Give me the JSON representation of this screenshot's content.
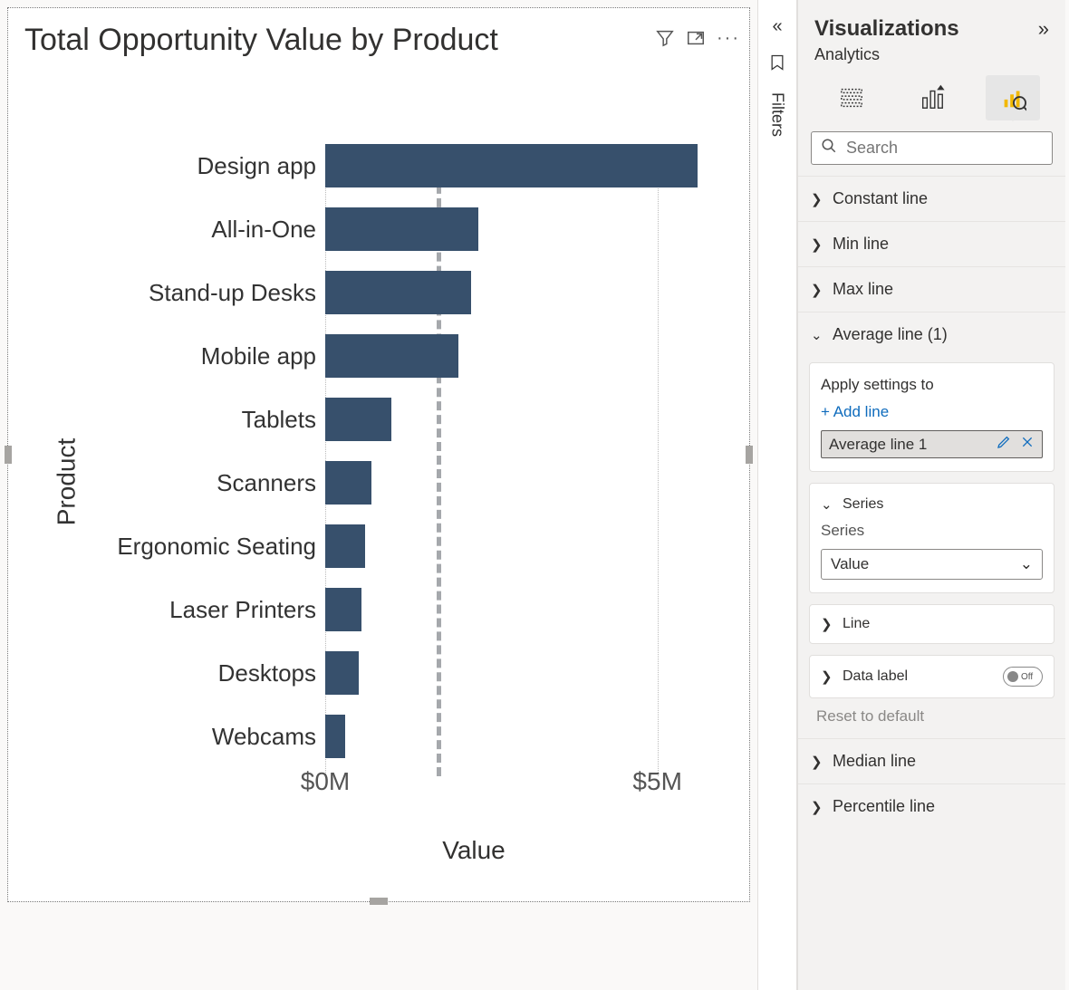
{
  "chart_data": {
    "type": "bar",
    "orientation": "horizontal",
    "title": "Total Opportunity Value by Product",
    "xlabel": "Value",
    "ylabel": "Product",
    "xlim": [
      0,
      6
    ],
    "ticks": [
      {
        "pos": 0,
        "label": "$0M"
      },
      {
        "pos": 5,
        "label": "$5M"
      }
    ],
    "average_line_value": 1.7,
    "categories": [
      "Design app",
      "All-in-One",
      "Stand-up Desks",
      "Mobile app",
      "Tablets",
      "Scanners",
      "Ergonomic Seating",
      "Laser Printers",
      "Desktops",
      "Webcams"
    ],
    "values": [
      5.6,
      2.3,
      2.2,
      2.0,
      1.0,
      0.7,
      0.6,
      0.55,
      0.5,
      0.3
    ]
  },
  "chart_actions": {
    "filter_tooltip": "Filters on this visual",
    "focus_tooltip": "Focus mode",
    "more_tooltip": "More options"
  },
  "filters_strip": {
    "label": "Filters"
  },
  "pane": {
    "title": "Visualizations",
    "subtitle": "Analytics",
    "search_placeholder": "Search",
    "sections": {
      "constant_line": "Constant line",
      "min_line": "Min line",
      "max_line": "Max line",
      "average_line": "Average line (1)",
      "median_line": "Median line",
      "percentile_line": "Percentile line"
    },
    "average_card": {
      "apply_label": "Apply settings to",
      "add_line": "+ Add line",
      "chip_label": "Average line 1"
    },
    "series_card": {
      "header": "Series",
      "field_label": "Series",
      "selected": "Value"
    },
    "line_card": {
      "header": "Line"
    },
    "data_label_card": {
      "header": "Data label",
      "toggle_state": "Off"
    },
    "reset": "Reset to default"
  }
}
